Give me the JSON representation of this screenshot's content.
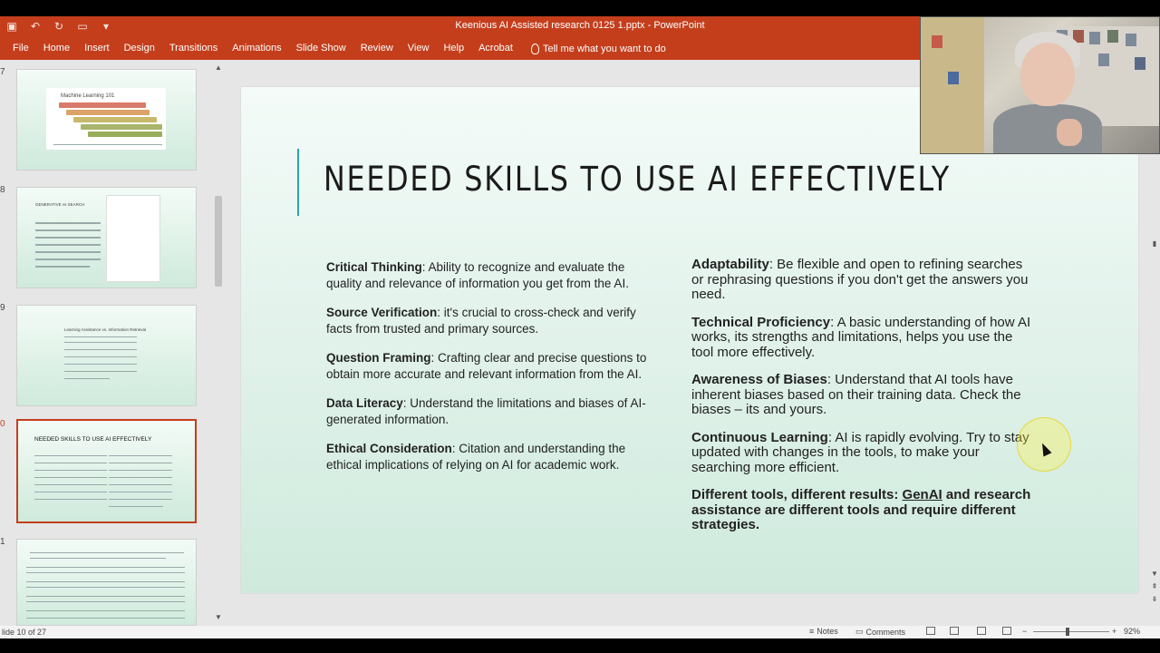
{
  "window": {
    "title": "Keenious AI Assisted research 0125  1.pptx  -  PowerPoint"
  },
  "ribbon": {
    "tabs": [
      "File",
      "Home",
      "Insert",
      "Design",
      "Transitions",
      "Animations",
      "Slide Show",
      "Review",
      "View",
      "Help",
      "Acrobat"
    ],
    "tell_me": "Tell me what you want to do"
  },
  "thumbnails": [
    {
      "num": "7",
      "title": "Machine Learning 101"
    },
    {
      "num": "8",
      "title": "GENERATIVE vs SEARCH"
    },
    {
      "num": "9",
      "title": "Learning Assistance vs. Information Retrieval"
    },
    {
      "num": "0",
      "title": "NEEDED SKILLS TO USE AI EFFECTIVELY"
    },
    {
      "num": "1",
      "title": ""
    }
  ],
  "slide": {
    "title": "NEEDED SKILLS TO USE AI EFFECTIVELY",
    "left": [
      {
        "term": "Critical Thinking",
        "text": ": Ability to recognize and evaluate the quality and relevance of information you get from the AI."
      },
      {
        "term": "Source Verification",
        "text": ": it's crucial to cross-check and verify facts from trusted and primary sources."
      },
      {
        "term": "Question Framing",
        "text": ": Crafting clear and precise questions to obtain more accurate and relevant information from the AI."
      },
      {
        "term": "Data Literacy",
        "text": ": Understand the limitations and biases of AI-generated information."
      },
      {
        "term": "Ethical Consideration",
        "text": ": Citation and understanding the ethical implications of relying on AI for academic work."
      }
    ],
    "right": [
      {
        "term": "Adaptability",
        "text": ": Be flexible and open to refining searches  or rephrasing questions if you don't get the answers you need."
      },
      {
        "term": "Technical Proficiency",
        "text": ": A basic understanding of how AI works, its strengths and limitations, helps you use the tool more effectively."
      },
      {
        "term": "Awareness of Biases",
        "text": ": Understand that AI tools have inherent biases based on their training data. Check the biases – its and yours."
      },
      {
        "term": "Continuous Learning",
        "text": ": AI is rapidly evolving. Try to stay updated with changes in the tools, to make your searching more efficient."
      }
    ],
    "closing_a": "Different tools, different results: ",
    "closing_u": "GenAI",
    "closing_b": " and research assistance are different tools and require different strategies."
  },
  "status": {
    "slide_info": "lide 10 of 27",
    "notes": "Notes",
    "comments": "Comments",
    "zoom": "92%"
  }
}
